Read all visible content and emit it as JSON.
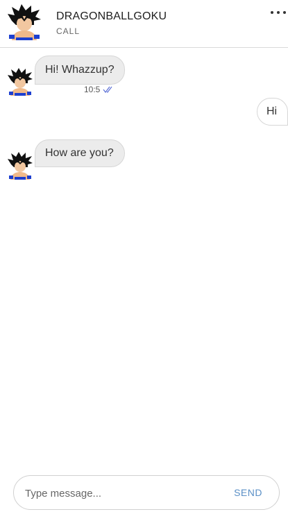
{
  "header": {
    "contact_name": "DRAGONBALLGOKU",
    "call_label": "CALL",
    "avatar_icon": "goku-avatar-icon",
    "more_icon": "more-dots-icon"
  },
  "messages": [
    {
      "direction": "incoming",
      "text": "Hi! Whazzup?",
      "time": "10:5",
      "status_icon": "double-check-icon"
    },
    {
      "direction": "outgoing",
      "text": "Hi"
    },
    {
      "direction": "incoming",
      "text": "How are you?"
    }
  ],
  "composer": {
    "placeholder": "Type message...",
    "value": "",
    "send_label": "SEND"
  },
  "colors": {
    "incoming_bubble": "#ececec",
    "send_accent": "#5a8fc6",
    "check_color": "#5b6fd6"
  }
}
